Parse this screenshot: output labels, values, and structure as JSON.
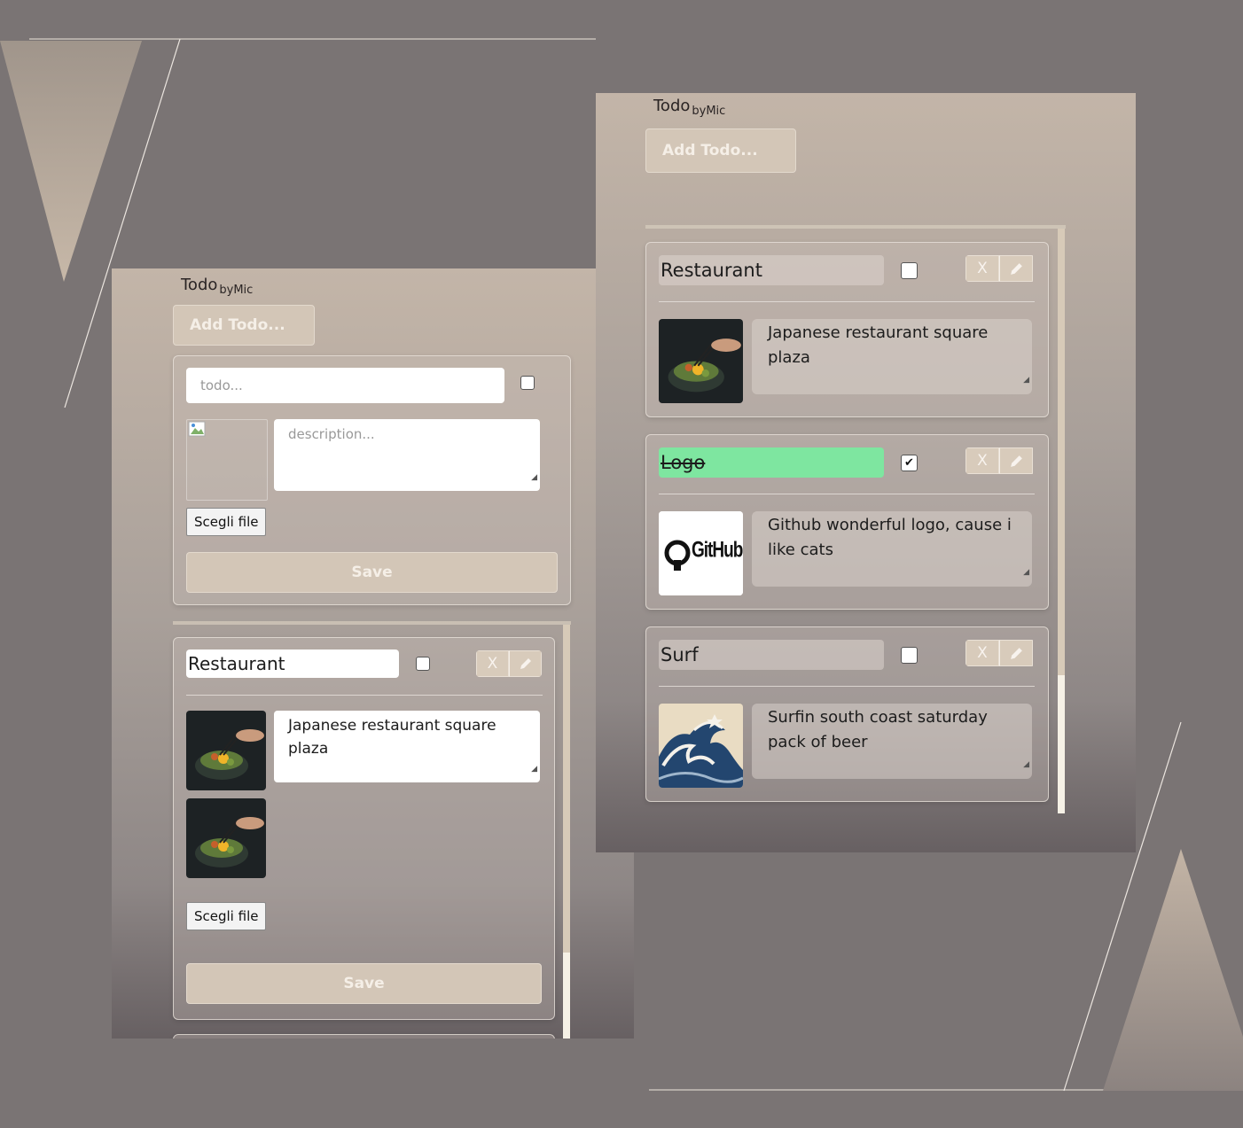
{
  "brand": {
    "name": "Todo",
    "by": "byMic"
  },
  "colors": {
    "background": "#7a7474",
    "accent": "#d3c6b7",
    "done": "#7ee6a0"
  },
  "left_window": {
    "add_button": "Add Todo...",
    "new_todo_form": {
      "title_placeholder": "todo...",
      "description_placeholder": "description...",
      "file_button": "Scegli file",
      "save_button": "Save"
    },
    "edit_item": {
      "title": "Restaurant",
      "description": "Japanese restaurant square plaza",
      "remove_label": "X",
      "file_button": "Scegli file",
      "save_button": "Save"
    }
  },
  "right_window": {
    "add_button": "Add Todo...",
    "todos": [
      {
        "title": "Restaurant",
        "done": false,
        "description": "Japanese restaurant square plaza",
        "image": "food-photo",
        "remove_label": "X"
      },
      {
        "title": "Logo",
        "done": true,
        "checkmark": "✔",
        "description": "Github wonderful logo, cause i like cats",
        "image": "github-logo",
        "image_text": "GitHub",
        "remove_label": "X"
      },
      {
        "title": "Surf",
        "done": false,
        "description": "Surfin south coast saturday pack of beer",
        "image": "wave-painting",
        "remove_label": "X"
      }
    ]
  }
}
